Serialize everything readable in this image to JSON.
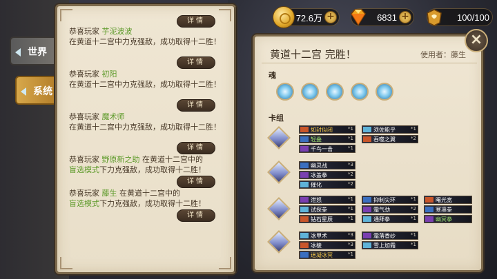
{
  "top_bar": {
    "coins": {
      "icon": "coin-icon",
      "value": "72.6万"
    },
    "gems": {
      "icon": "diamond-icon",
      "value": "6831"
    },
    "stamina": {
      "icon": "stamina-icon",
      "value": "100/100"
    }
  },
  "tabs": [
    {
      "label": "世界",
      "active": false
    },
    {
      "label": "系统",
      "active": true
    }
  ],
  "feed": {
    "detail_label": "详情",
    "items": [
      {
        "prefix": "恭喜玩家",
        "name": "芋泥波波",
        "text": "在黄道十二宫中力克强敌，成功取得十二胜！"
      },
      {
        "prefix": "恭喜玩家",
        "name": "初阳",
        "text": "在黄道十二宫中力克强敌，成功取得十二胜！"
      },
      {
        "prefix": "恭喜玩家",
        "name": "魔术师",
        "text": "在黄道十二宫中力克强敌，成功取得十二胜！"
      },
      {
        "prefix": "恭喜玩家",
        "name": "野原新之助",
        "text_a": "在黄道十二宫中的",
        "mode": "盲选模式",
        "text_b": "下力克强敌，成功取得十二胜！"
      },
      {
        "prefix": "恭喜玩家",
        "name": "藤生",
        "text_a": "在黄道十二宫中的",
        "mode": "盲选模式",
        "text_b": "下力克强敌，成功取得十二胜！"
      }
    ]
  },
  "result": {
    "title": "黄道十二宫 完胜！",
    "user_label": "使用者：藤生",
    "soul_label": "魂",
    "deck_label": "卡组",
    "close_icon": "close-icon",
    "decks": [
      {
        "cards": [
          {
            "name": "如封似闭",
            "count": "*1",
            "tone": "g"
          },
          {
            "name": "轻叠",
            "count": "*1",
            "tone": "gr"
          },
          {
            "name": "千鸟一击",
            "count": "*1",
            "tone": ""
          },
          {
            "name": "须佐能乎",
            "count": "*1",
            "tone": ""
          },
          {
            "name": "吞噬之翼",
            "count": "*2",
            "tone": ""
          }
        ]
      },
      {
        "cards": [
          {
            "name": "幽灵战",
            "count": "*3",
            "tone": ""
          },
          {
            "name": "冰盖拳",
            "count": "*2",
            "tone": ""
          },
          {
            "name": "催化",
            "count": "*2",
            "tone": ""
          }
        ]
      },
      {
        "cards": [
          {
            "name": "泄怒",
            "count": "*1",
            "tone": ""
          },
          {
            "name": "试探拳",
            "count": "*1",
            "tone": ""
          },
          {
            "name": "钻石星辰",
            "count": "*1",
            "tone": ""
          },
          {
            "name": "抑制尖环",
            "count": "*1",
            "tone": ""
          },
          {
            "name": "霜气劲",
            "count": "*2",
            "tone": ""
          },
          {
            "name": "通拜拳",
            "count": "*1",
            "tone": ""
          },
          {
            "name": "曙光宽",
            "count": "",
            "tone": ""
          },
          {
            "name": "寒凛拳",
            "count": "",
            "tone": ""
          },
          {
            "name": "幽冥拳",
            "count": "",
            "tone": "gr"
          }
        ]
      },
      {
        "cards": [
          {
            "name": "冰甲术",
            "count": "*3",
            "tone": ""
          },
          {
            "name": "冰棱",
            "count": "*3",
            "tone": ""
          },
          {
            "name": "迷凝冰冥",
            "count": "*1",
            "tone": "g"
          },
          {
            "name": "霜落香纱",
            "count": "*1",
            "tone": ""
          },
          {
            "name": "雪上加霜",
            "count": "*1",
            "tone": ""
          }
        ]
      }
    ]
  }
}
